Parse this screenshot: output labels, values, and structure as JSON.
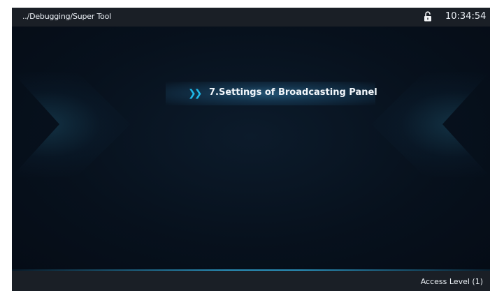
{
  "header": {
    "breadcrumb": "../Debugging/Super Tool",
    "clock": "10:34:54",
    "lock_icon": "unlocked-padlock-icon"
  },
  "menu": {
    "items": [
      {
        "arrow_icon": "double-chevron-right-icon",
        "label": "7.Settings of Broadcasting Panel"
      }
    ]
  },
  "footer": {
    "access_level": "Access Level  (1)"
  },
  "colors": {
    "background": "#06101c",
    "bar": "#1a1f26",
    "accent": "#1fb8e8"
  }
}
